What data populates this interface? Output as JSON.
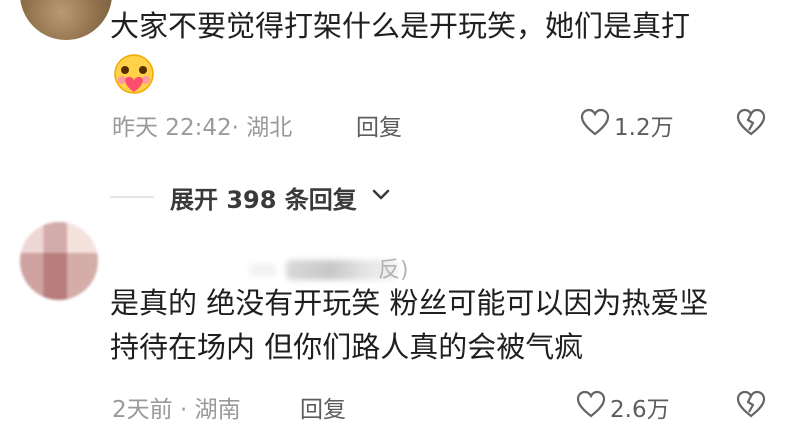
{
  "comment1": {
    "text_line1": "大家不要觉得打架什么是开玩笑，她们是真打",
    "emoji": "heart-face-emoji",
    "meta": "昨天 22:42· 湖北",
    "reply_label": "回复",
    "likes": "1.2万"
  },
  "expand": {
    "label": "展开 398 条回复"
  },
  "comment2": {
    "username_suffix": "反)",
    "text_line1": "是真的 绝没有开玩笑 粉丝可能可以因为热爱坚",
    "text_line2": "持待在场内 但你们路人真的会被气疯",
    "meta": "2天前 · 湖南",
    "reply_label": "回复",
    "likes": "2.6万"
  },
  "colors": {
    "text": "#1f1f1f",
    "meta": "#9a9a9a",
    "action": "#5d5d5d",
    "emoji_face": "#ffd24a",
    "emoji_heart": "#ff4d6d"
  }
}
